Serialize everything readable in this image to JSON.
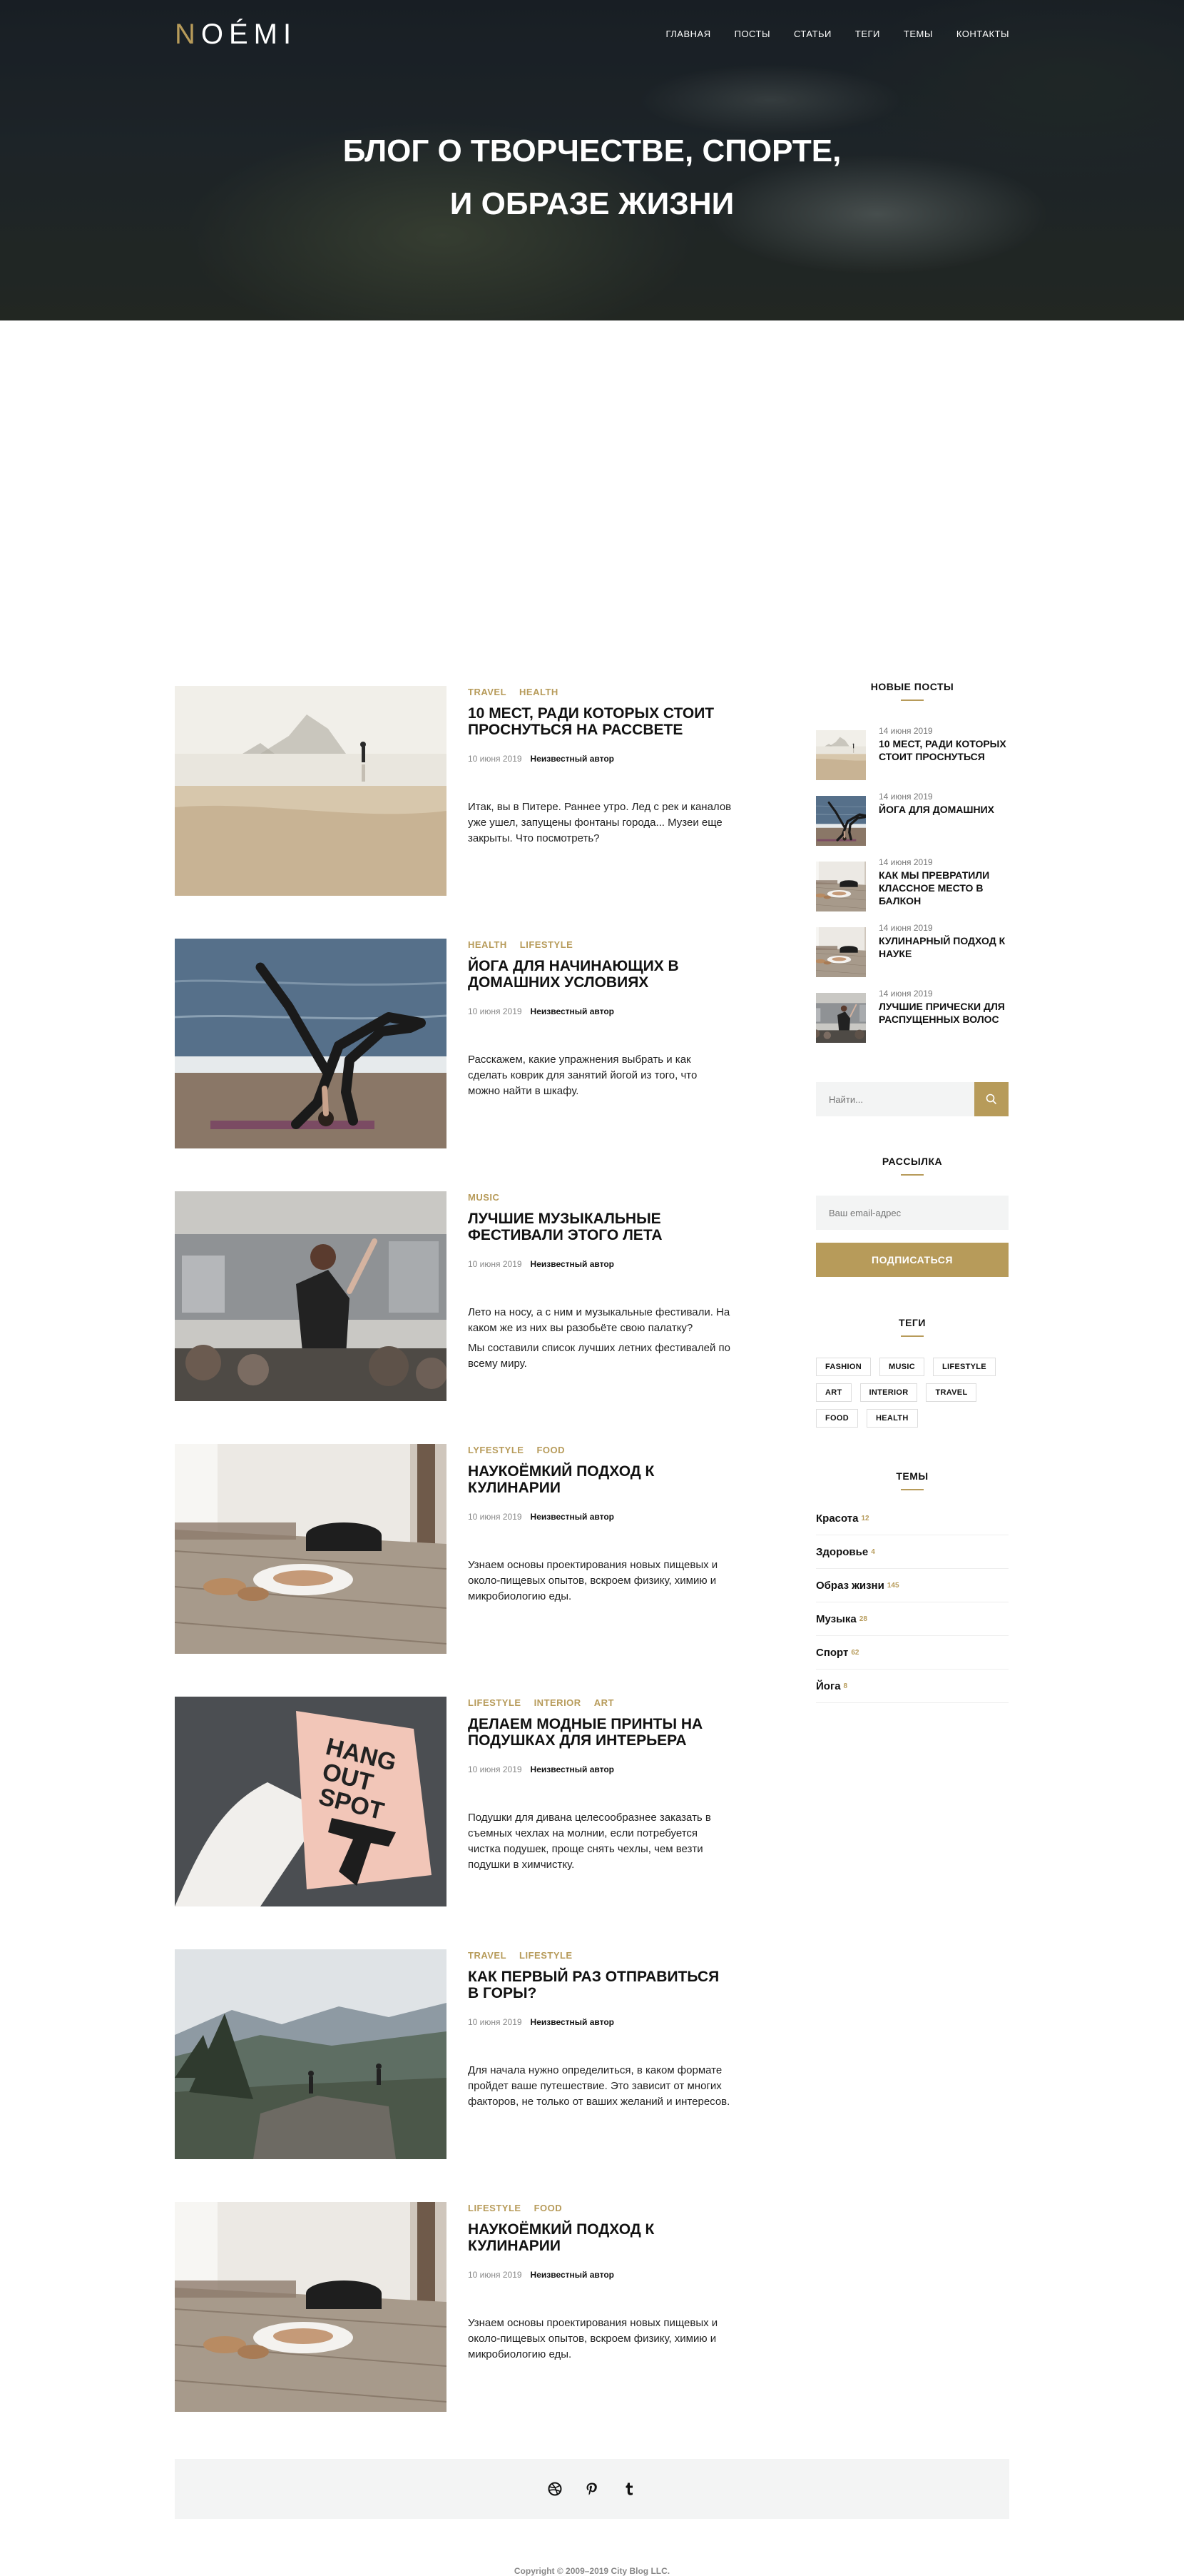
{
  "site": {
    "logo_first": "N",
    "logo_rest": "OÉMI",
    "accent_color": "#b79b5a"
  },
  "nav": [
    {
      "label": "ГЛАВНАЯ"
    },
    {
      "label": "ПОСТЫ"
    },
    {
      "label": "СТАТЬИ"
    },
    {
      "label": "ТЕГИ"
    },
    {
      "label": "ТЕМЫ"
    },
    {
      "label": "КОНТАКТЫ"
    }
  ],
  "hero": {
    "line1": "БЛОГ О ТВОРЧЕСТВЕ, СПОРТЕ,",
    "line2": "И ОБРАЗЕ ЖИЗНИ"
  },
  "posts": [
    {
      "tags": [
        "TRAVEL",
        "HEALTH"
      ],
      "title": "10 мест, ради которых стоит проснуться на рассвете",
      "date": "10 июня 2019",
      "author": "Неизвестный автор",
      "excerpt": [
        "Итак, вы в Питере. Раннее утро. Лед с рек и каналов уже ушел, запущены фонтаны города... Музеи еще закрыты. Что посмотреть?"
      ],
      "image": "beach-sunrise"
    },
    {
      "tags": [
        "HEALTH",
        "LIFESTYLE"
      ],
      "title": "Йога для начинающих в домашних условиях",
      "date": "10 июня 2019",
      "author": "Неизвестный автор",
      "excerpt": [
        "Расскажем, какие упражнения выбрать и как сделать коврик для занятий йогой из того, что можно найти в шкафу."
      ],
      "image": "yoga-beach"
    },
    {
      "tags": [
        "MUSIC"
      ],
      "title": "Лучшие музыкальные фестивали этого лета",
      "date": "10 июня 2019",
      "author": "Неизвестный автор",
      "excerpt": [
        "Лето на носу, а с ним и музыкальные фестивали. На каком же из них вы разобьёте свою палатку?",
        "Мы составили список лучших летних фестивалей по всему миру."
      ],
      "image": "festival"
    },
    {
      "tags": [
        "LYFESTYLE",
        "FOOD"
      ],
      "title": "Наукоёмкий подход к кулинарии",
      "date": "10 июня 2019",
      "author": "Неизвестный автор",
      "excerpt": [
        "Узнаем основы проектирования новых пищевых и около-пищевых опытов, вскроем физику, химию и микробиологию еды."
      ],
      "image": "kitchen-table"
    },
    {
      "tags": [
        "LIFESTYLE",
        "INTERIOR",
        "ART"
      ],
      "title": "Делаем модные принты на подушках для интерьера",
      "date": "10 июня 2019",
      "author": "Неизвестный автор",
      "excerpt": [
        "Подушки для дивана целесообразнее заказать в съемных чехлах на молнии, если потребуется чистка подушек, проще снять чехлы, чем везти подушки в химчистку."
      ],
      "image": "pillow",
      "image_text": [
        "HANG",
        "OUT",
        "SPOT"
      ]
    },
    {
      "tags": [
        "TRAVEL",
        "LIFESTYLE"
      ],
      "title": "Как первый раз отправиться в горы?",
      "date": "10 июня 2019",
      "author": "Неизвестный автор",
      "excerpt": [
        "Для начала нужно определиться, в каком формате пройдет ваше путешествие. Это зависит от многих факторов, не только от ваших желаний и интересов."
      ],
      "image": "mountains"
    },
    {
      "tags": [
        "LIFESTYLE",
        "FOOD"
      ],
      "title": "Наукоёмкий подход к кулинарии",
      "date": "10 июня 2019",
      "author": "Неизвестный автор",
      "excerpt": [
        "Узнаем основы проектирования новых пищевых и около-пищевых опытов, вскроем физику, химию и микробиологию еды."
      ],
      "image": "kitchen-table"
    }
  ],
  "sidebar": {
    "recent_title": "НОВЫЕ ПОСТЫ",
    "recent": [
      {
        "date": "14 июня 2019",
        "title": "10 мест, ради которых стоит проснуться",
        "image": "beach-sunrise"
      },
      {
        "date": "14 июня 2019",
        "title": "Йога для домашних",
        "image": "yoga-beach"
      },
      {
        "date": "14 июня 2019",
        "title": "Как мы превратили классное место в балкон",
        "image": "kitchen-table"
      },
      {
        "date": "14 июня 2019",
        "title": "Кулинарный подход к науке",
        "image": "kitchen-table"
      },
      {
        "date": "14 июня 2019",
        "title": "Лучшие прически для распущенных волос",
        "image": "festival"
      }
    ],
    "search_placeholder": "Найти...",
    "newsletter_title": "РАССЫЛКА",
    "email_placeholder": "Ваш email-адрес",
    "subscribe_label": "ПОДПИСАТЬСЯ",
    "tags_title": "ТЕГИ",
    "tagcloud": [
      "FASHION",
      "MUSIC",
      "LIFESTYLE",
      "ART",
      "INTERIOR",
      "TRAVEL",
      "FOOD",
      "HEALTH"
    ],
    "themes_title": "ТЕМЫ",
    "themes": [
      {
        "name": "Красота",
        "count": "12"
      },
      {
        "name": "Здоровье",
        "count": "4"
      },
      {
        "name": "Образ жизни",
        "count": "145"
      },
      {
        "name": "Музыка",
        "count": "28"
      },
      {
        "name": "Спорт",
        "count": "62"
      },
      {
        "name": "Йога",
        "count": "8"
      }
    ]
  },
  "footer": {
    "social": [
      "dribbble-icon",
      "pinterest-icon",
      "tumblr-icon"
    ],
    "copyright": "Copyright © 2009–2019 City Blog LLC."
  }
}
